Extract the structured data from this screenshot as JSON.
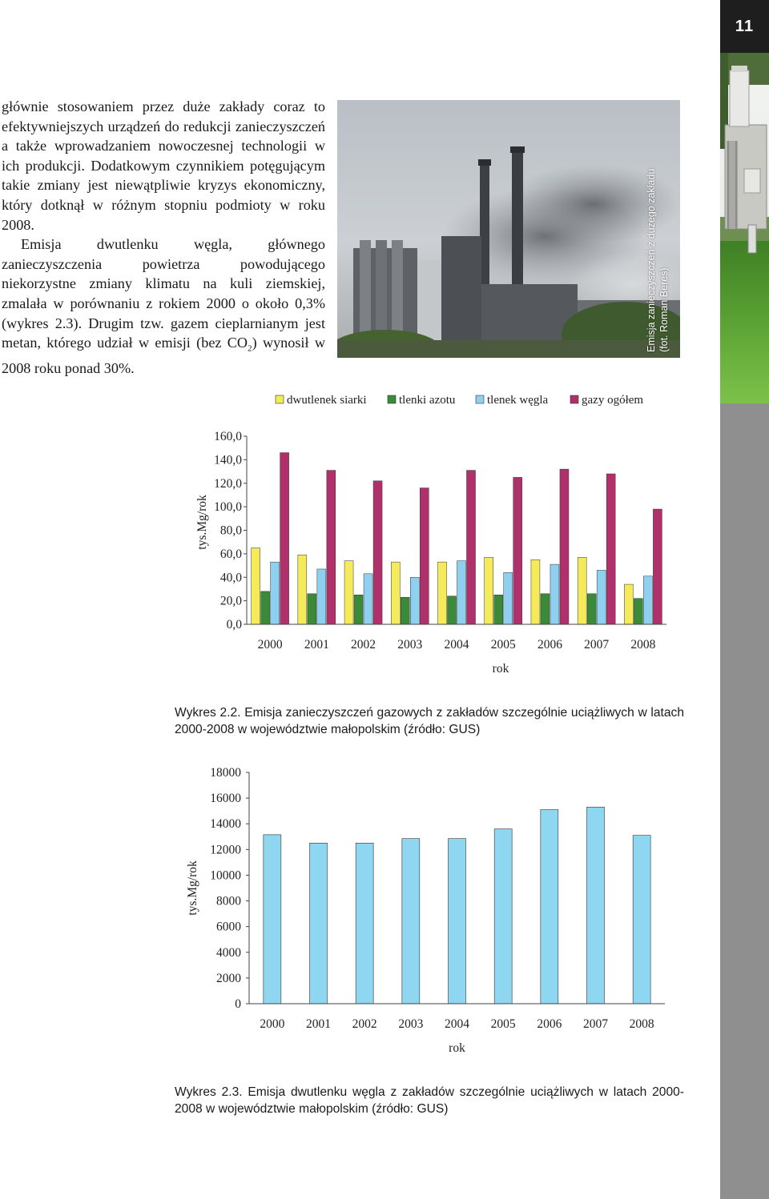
{
  "page_number": "11",
  "body": {
    "p1": "głównie stosowaniem przez duże zakłady coraz to efektywniejszych urządzeń do redukcji zanieczyszczeń a także wprowadzaniem nowoczesnej technologii w ich produkcji. Dodatkowym czynnikiem potęgującym takie zmiany jest niewątpliwie kryzys ekonomiczny, który dotknął w różnym stopniu podmioty w roku 2008.",
    "p2_before": "Emisja dwutlenku węgla, głównego zanieczyszczenia powietrza powodującego niekorzystne zmiany klimatu na kuli ziemskiej, zmalała w porównaniu z rokiem 2000 o około 0,3% (wykres 2.3). Drugim tzw. gazem cieplarnianym jest metan, którego udział w emisji (bez ",
    "p2_co": "CO",
    "p2_sub": "2",
    "p2_after": ") wynosił w 2008 roku ponad 30%."
  },
  "photo": {
    "caption_line1": "Emisja zanieczyszczeń z dużego zakładu",
    "caption_line2": "(fot. Roman Bereś)"
  },
  "colors": {
    "dwutlenek_siarki": "#f5ea5a",
    "tlenki_azotu": "#3a8a3a",
    "tlenek_wegla": "#8fd0f0",
    "gazy_ogolem": "#b0306c",
    "co2_bars": "#8fd6f0"
  },
  "chart_data": [
    {
      "type": "bar",
      "categories": [
        "2000",
        "2001",
        "2002",
        "2003",
        "2004",
        "2005",
        "2006",
        "2007",
        "2008"
      ],
      "series": [
        {
          "name": "dwutlenek siarki",
          "values": [
            65,
            59,
            54,
            53,
            53,
            57,
            55,
            57,
            34
          ]
        },
        {
          "name": "tlenki azotu",
          "values": [
            28,
            26,
            25,
            23,
            24,
            25,
            26,
            26,
            22
          ]
        },
        {
          "name": "tlenek węgla",
          "values": [
            53,
            47,
            43,
            40,
            54,
            44,
            51,
            46,
            41
          ]
        },
        {
          "name": "gazy ogółem",
          "values": [
            146,
            131,
            122,
            116,
            131,
            125,
            132,
            128,
            98
          ]
        }
      ],
      "xlabel": "rok",
      "ylabel": "tys.Mg/rok",
      "ylim": [
        0,
        160
      ],
      "yticks": [
        "0,0",
        "20,0",
        "40,0",
        "60,0",
        "80,0",
        "100,0",
        "120,0",
        "140,0",
        "160,0"
      ],
      "legend": "top",
      "grid": false
    },
    {
      "type": "bar",
      "categories": [
        "2000",
        "2001",
        "2002",
        "2003",
        "2004",
        "2005",
        "2006",
        "2007",
        "2008"
      ],
      "series": [
        {
          "values": [
            13150,
            12500,
            12500,
            12850,
            12850,
            13600,
            15100,
            15300,
            13100
          ]
        }
      ],
      "xlabel": "rok",
      "ylabel": "tys.Mg/rok",
      "ylim": [
        0,
        18000
      ],
      "yticks": [
        "0",
        "2000",
        "4000",
        "6000",
        "8000",
        "10000",
        "12000",
        "14000",
        "16000",
        "18000"
      ],
      "grid": false
    }
  ],
  "captions": {
    "wykres_2_2": "Wykres 2.2. Emisja zanieczyszczeń gazowych z zakładów szczególnie uciążliwych w latach 2000-2008 w województwie małopolskim (źródło: GUS)",
    "wykres_2_3": "Wykres 2.3. Emisja dwutlenku węgla z zakładów szczególnie uciążliwych w latach 2000-2008 w województwie małopolskim (źródło: GUS)"
  }
}
